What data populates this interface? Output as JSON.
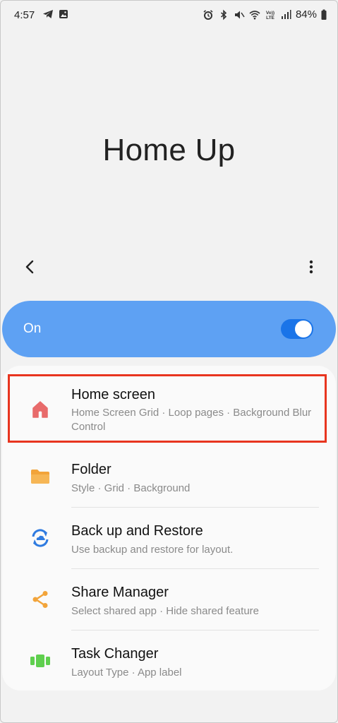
{
  "status_bar": {
    "time": "4:57",
    "battery": "84%",
    "icons": [
      "telegram-icon",
      "gallery-icon",
      "alarm-icon",
      "bluetooth-icon",
      "mute-icon",
      "wifi-icon",
      "volte-icon",
      "signal-icon",
      "battery-icon"
    ]
  },
  "app": {
    "title": "Home Up"
  },
  "toolbar": {
    "back_icon": "chevron-left-icon",
    "more_icon": "more-vertical-icon"
  },
  "master_switch": {
    "label": "On",
    "checked": true,
    "accent": "#5ea1f3",
    "toggle_color": "#1a74e8"
  },
  "menu": {
    "items": [
      {
        "title": "Home screen",
        "subtitle": "Home Screen Grid · Loop pages · Background Blur Control",
        "icon": "home-icon",
        "icon_color": "#e86b6b"
      },
      {
        "title": "Folder",
        "subtitle": "Style · Grid · Background",
        "icon": "folder-icon",
        "icon_color": "#f2a43a"
      },
      {
        "title": "Back up and Restore",
        "subtitle": "Use backup and restore for layout.",
        "icon": "backup-restore-icon",
        "icon_color": "#2f7be0"
      },
      {
        "title": "Share Manager",
        "subtitle": "Select shared app · Hide shared feature",
        "icon": "share-icon",
        "icon_color": "#f2a43a"
      },
      {
        "title": "Task Changer",
        "subtitle": "Layout Type · App label",
        "icon": "task-changer-icon",
        "icon_color": "#5fcf4e"
      }
    ],
    "highlight_color": "#e8351f"
  }
}
